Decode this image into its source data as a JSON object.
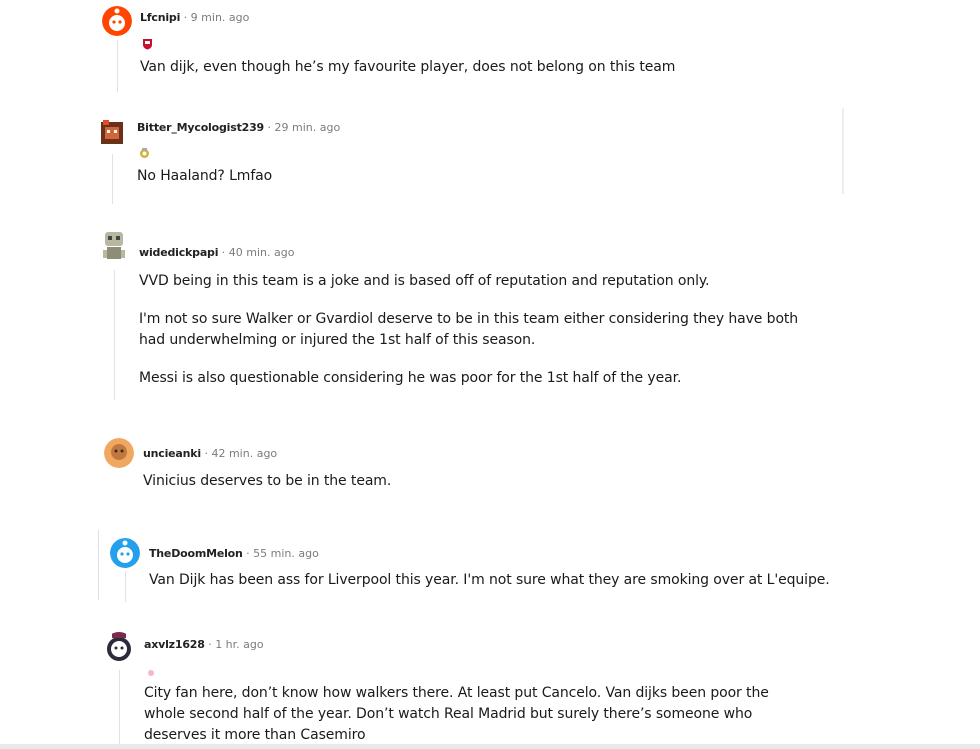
{
  "separator": "·",
  "comments": [
    {
      "author": "Lfcnipi",
      "time": "9 min. ago",
      "has_flair": true,
      "flair_color": "#c8102e",
      "paragraphs": [
        "Van dijk, even though he’s my favourite player, does not belong on this team"
      ]
    },
    {
      "author": "Bitter_Mycologist239",
      "time": "29 min. ago",
      "has_flair": true,
      "flair_color": "#d4af37",
      "paragraphs": [
        "No Haaland? Lmfao"
      ]
    },
    {
      "author": "widedickpapi",
      "time": "40 min. ago",
      "has_flair": false,
      "paragraphs": [
        "VVD being in this team is a joke and is based off of reputation and reputation only.",
        "I'm not so sure Walker or Gvardiol deserve to be in this team either considering they have both had underwhelming or injured the 1st half of this season.",
        "Messi is also questionable considering he was poor for the 1st half of the year."
      ]
    },
    {
      "author": "uncieanki",
      "time": "42 min. ago",
      "has_flair": false,
      "paragraphs": [
        "Vinicius deserves to be in the team."
      ]
    },
    {
      "author": "TheDoomMelon",
      "time": "55 min. ago",
      "has_flair": false,
      "paragraphs": [
        "Van Dijk has been ass for Liverpool this year. I'm not sure what they are smoking over at L'equipe."
      ]
    },
    {
      "author": "axvlz1628",
      "time": "1 hr. ago",
      "has_flair": true,
      "flair_color": "#f4b8c8",
      "paragraphs": [
        "City fan here, don’t know how walkers there. At least put Cancelo. Van dijks been poor the whole second half of the year. Don’t watch Real Madrid but surely there’s someone who deserves it more than Casemiro"
      ]
    }
  ],
  "avatars": [
    {
      "icon": "snoo-red-avatar-icon",
      "bg": "#ff4500"
    },
    {
      "icon": "snoo-pixel-avatar-icon",
      "bg": "#6b2f1a"
    },
    {
      "icon": "snoo-robot-avatar-icon",
      "bg": "#b8b8a0"
    },
    {
      "icon": "snoo-orange-avatar-icon",
      "bg": "#f0a860"
    },
    {
      "icon": "snoo-blue-avatar-icon",
      "bg": "#24a0ed"
    },
    {
      "icon": "snoo-hat-avatar-icon",
      "bg": "#2b2b3a"
    }
  ]
}
